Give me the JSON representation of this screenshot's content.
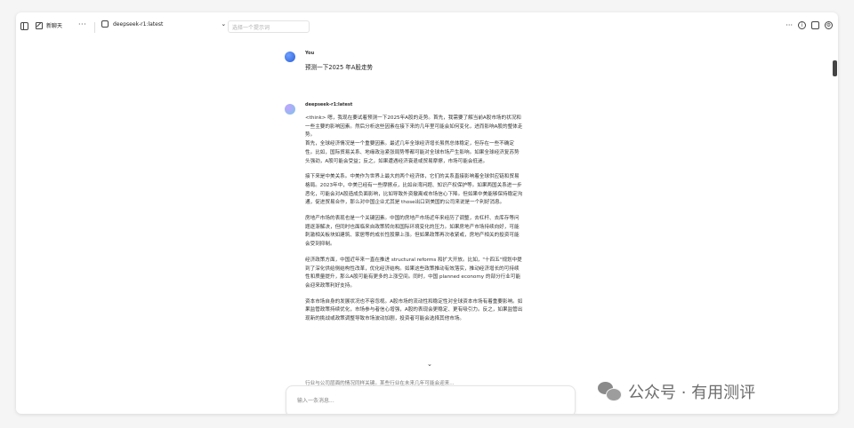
{
  "topbar": {
    "new_chat_label": "新聊天",
    "model_name": "deepseek-r1:latest",
    "prompt_placeholder": "选择一个提示词"
  },
  "icons": {
    "sidebar": "sidebar-toggle-icon",
    "new_chat": "edit-icon",
    "more": "more-dots-icon",
    "model": "robot-icon",
    "chevron": "chevron-down-icon",
    "settings": "gear-icon",
    "info": "info-icon",
    "share": "share-icon"
  },
  "messages": {
    "user": {
      "name": "You",
      "text": "预测一下2025 年A股走势"
    },
    "bot": {
      "name": "deepseek-r1:latest",
      "paragraphs": [
        "<think> 嗯，我现在要试着预测一下2025年A股的走势。首先，我需要了解当前A股市场的状况和一些主要的影响因素。然后分析这些因素在接下来的几年里可能会如何变化，进而影响A股的整体走势。\n首先，全球经济情况是一个重要因素。最近几年全球经济增长虽然总体稳定，但存在一些不确定性。比如，国际贸易关系、地缘政治紧张局势等都可能对全球市场产生影响。如果全球经济复苏势头强劲，A股可能会受益；反之，如果遭遇经济衰退或贸易摩擦，市场可能会低迷。",
        "接下来是中美关系。中美作为世界上最大的两个经济体，它们的关系直接影响着全球供应链和贸易格局。2023年中，中美已经有一些摩擦点，比如台湾问题、知识产权保护等。如果两国关系进一步恶化，可能会对A股造成负面影响，比如导致外资撤离或市场信心下降。但如果中美能够保持稳定沟通，促进贸易合作，那么对中国企业尤其是 those出口到美国的公司来说是一个利好消息。",
        "房地产市场的表现也是一个关键因素。中国的房地产市场近年来经历了调整，去杠杆、去库存等问题逐渐解决，但同时也面临来自政策转向和国际环境变化的压力。如果房地产市场持续向好，可能刺激相关板块如建筑、家居等的成长性股票上涨。但如果政策再次收紧或，房地产相关的投资可能会受到抑制。",
        "经济政策方面，中国近年来一直在推进 structural reforms 和扩大开放。比如，\"十四五\"规划中提到了深化供给侧结构性改革，优化经济结构。如果这些政策推动有效落实，推动经济增长的可持续性和质量提升，那么A股可能有更多的上涨空间。同时，中国 planned economy 的部分行业可能会迎来政策利好支持。",
        "资本市场自身的发展状况也不容忽视。A股市场的流动性和稳定性对全球资本市场有着重要影响。如果监管政策持续优化，市场参与者信心增强，A股的表现会更稳定、更有吸引力。反之，如果监管出现新的挑战或政策调整导致市场波动加剧，投资者可能会选择其他市场。"
      ],
      "cut_line": "行业与公司层面的情况同样关键。某些行业在未来几年可能会迎来..."
    }
  },
  "input": {
    "placeholder": "输入一条消息..."
  },
  "watermark": {
    "text": "公众号 · 有用测评"
  }
}
